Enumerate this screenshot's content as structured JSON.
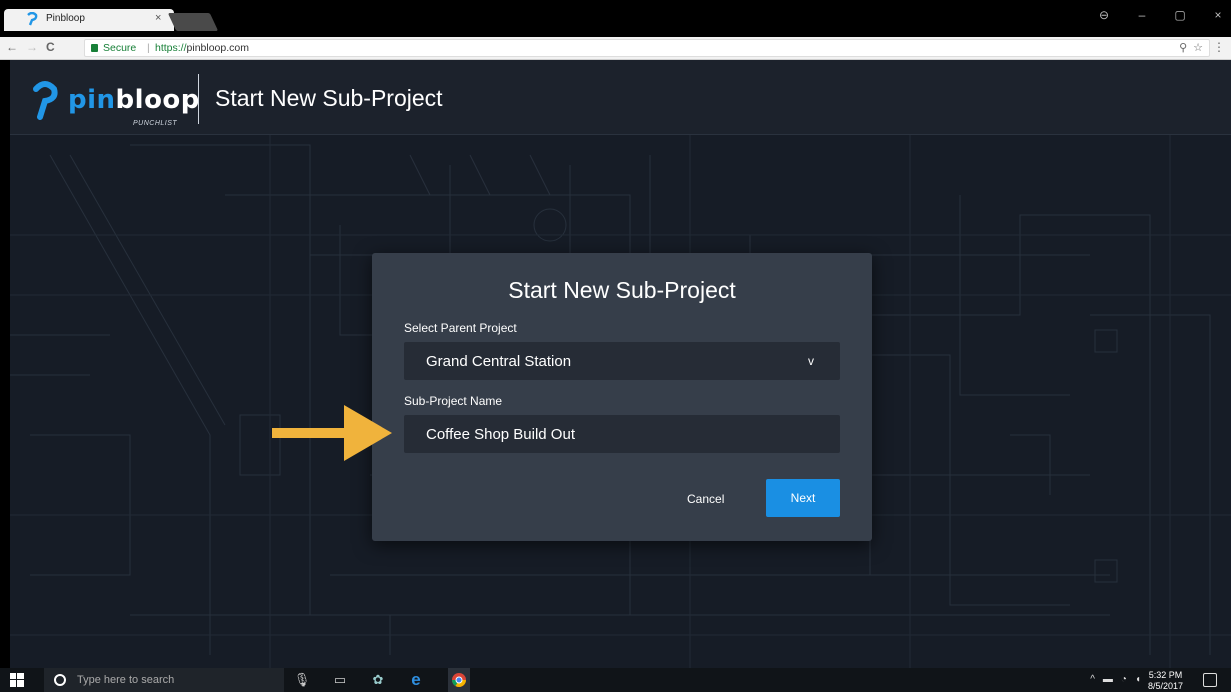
{
  "browser": {
    "tab_title": "Pinbloop",
    "tab_close": "×",
    "secure_label": "Secure",
    "url_protocol": "https://",
    "url_host": "pinbloop.com",
    "back_icon": "←",
    "forward_icon": "→",
    "reload_icon": "C",
    "zoom_icon": "⚲",
    "star_icon": "☆",
    "menu_icon": "⋮",
    "window_controls": [
      "–",
      "▢",
      "×"
    ],
    "profile_icon": "⊖"
  },
  "app": {
    "logo_word_pin": "pin",
    "logo_word_rest": "bloop",
    "logo_sub": "PUNCHLIST",
    "header_title": "Start New Sub-Project",
    "brand_color": "#2196e6"
  },
  "modal": {
    "title": "Start New Sub-Project",
    "parent_label": "Select Parent Project",
    "parent_value": "Grand Central Station",
    "parent_chevron": "v",
    "name_label": "Sub-Project Name",
    "name_value": "Coffee Shop Build Out",
    "cancel_label": "Cancel",
    "next_label": "Next"
  },
  "taskbar": {
    "search_placeholder": "Type here to search",
    "time": "5:32 PM",
    "date": "8/5/2017"
  }
}
